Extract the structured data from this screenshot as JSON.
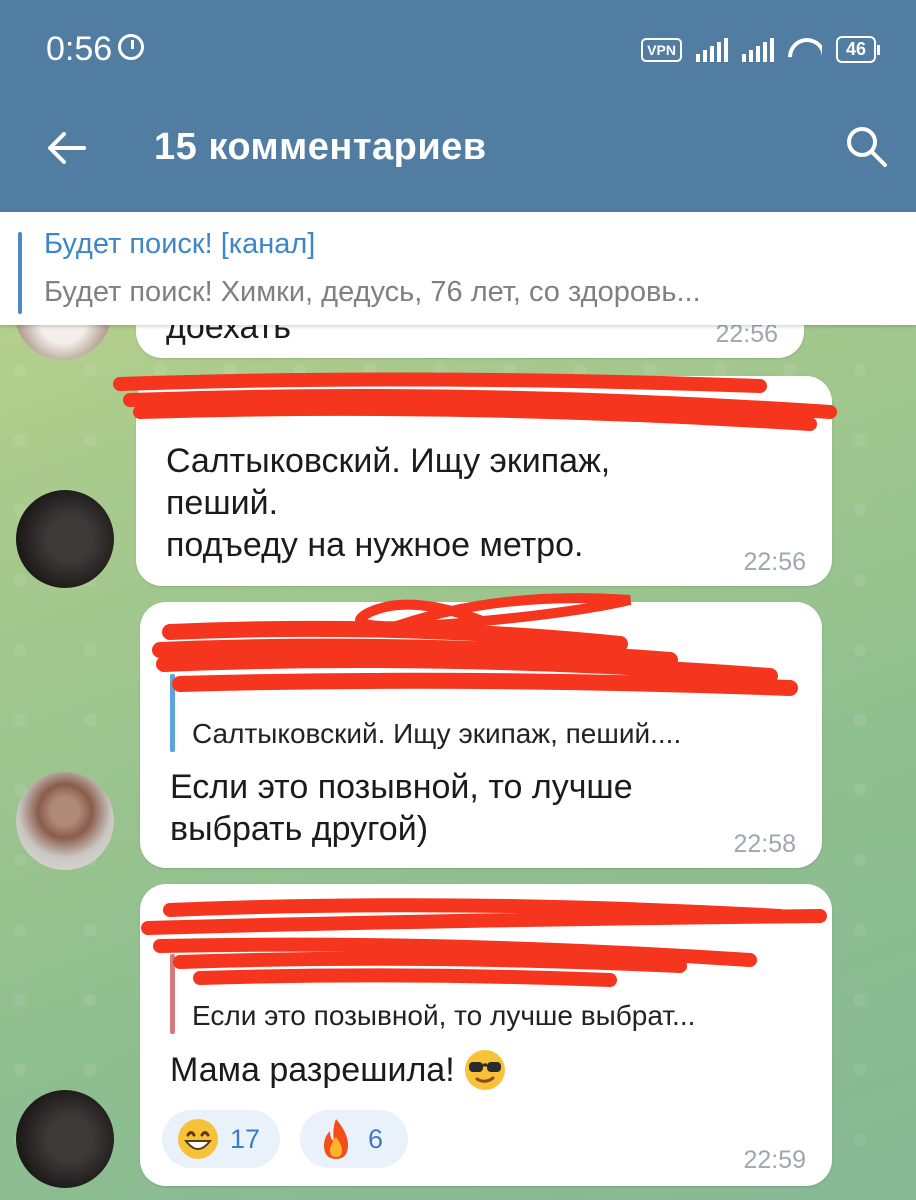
{
  "status_bar": {
    "time": "0:56",
    "vpn_label": "VPN",
    "battery": "46",
    "icons": [
      "alarm-icon",
      "signal-icon",
      "wifi-icon",
      "battery-icon"
    ]
  },
  "header": {
    "title": "15 комментариев",
    "back_icon": "arrow-left-icon",
    "search_icon": "search-icon",
    "bg_color": "#517da2"
  },
  "pinned": {
    "title": "Будет поиск! [канал]",
    "text": "Будет поиск! Химки, дедусь, 76 лет, со здоровь..."
  },
  "messages": [
    {
      "text": "доехать",
      "time": "22:56"
    },
    {
      "text": "Салтыковский. Ищу экипаж,\nпеший.\nподъеду на нужное метро.",
      "time": "22:56"
    },
    {
      "reply_text": "Салтыковский. Ищу экипаж, пеший....",
      "text": "Если это позывной, то лучше\nвыбрать другой)",
      "time": "22:58"
    },
    {
      "reply_text": "Если это позывной, то лучше выбрат...",
      "text": "Мама разрешила!",
      "time": "22:59",
      "reactions": [
        {
          "icon": "grin-emoji-icon",
          "count": "17"
        },
        {
          "icon": "fire-emoji-icon",
          "count": "6"
        }
      ]
    }
  ]
}
